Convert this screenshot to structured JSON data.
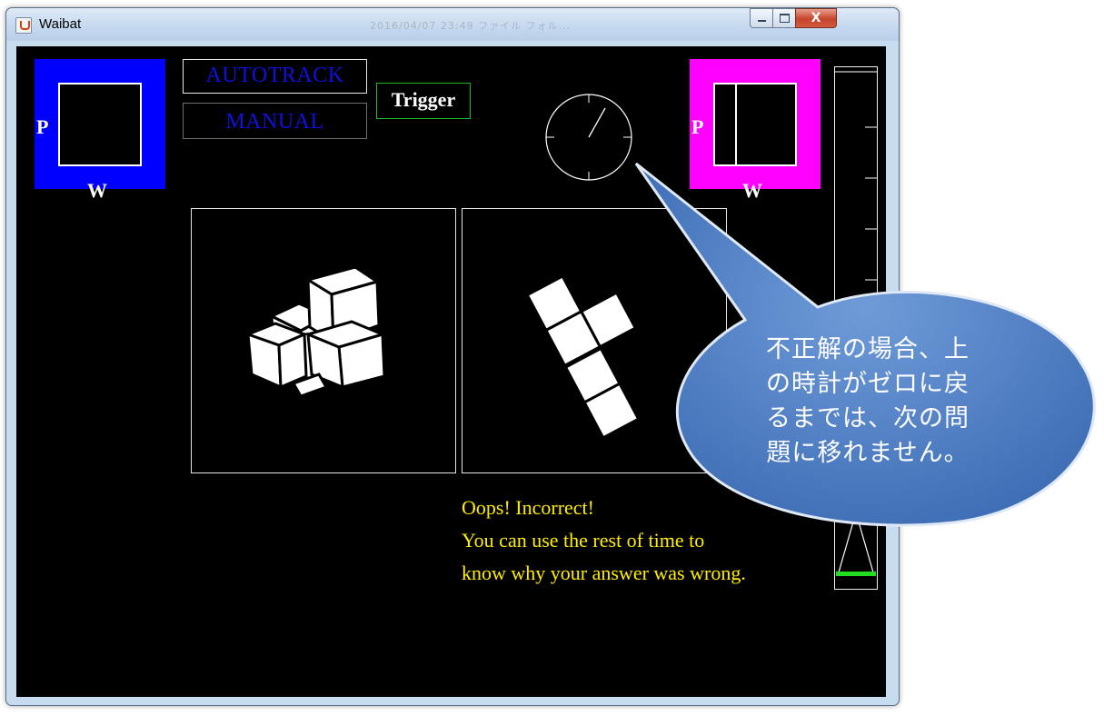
{
  "window": {
    "title": "Waibat",
    "title_ghost": "2016/04/07 23:49   ファイル フォル...",
    "close_label": "X"
  },
  "left_panel": {
    "p_label": "P",
    "w_label": "W",
    "color": "#0000ff",
    "level": 0
  },
  "right_panel": {
    "p_label": "P",
    "w_label": "W",
    "color": "#ff00ff",
    "level": 1.0
  },
  "mode_buttons": {
    "autotrack": "AUTOTRACK",
    "manual": "MANUAL",
    "accent": "#1010e0"
  },
  "trigger": {
    "label": "Trigger",
    "border_color": "#22bb22"
  },
  "feedback": {
    "line1": "Oops! Incorrect!",
    "line2": "You can use the rest of time to",
    "line3": "know why your answer was wrong.",
    "color": "#ffee00"
  },
  "callout": {
    "line1": "不正解の場合、上",
    "line2": "の時計がゼロに戻",
    "line3": "るまでは、次の問",
    "line4": "題に移れません。",
    "fill": "#4a79c0"
  },
  "gauge": {
    "level": 0.03,
    "fill_color": "#22dd22"
  }
}
